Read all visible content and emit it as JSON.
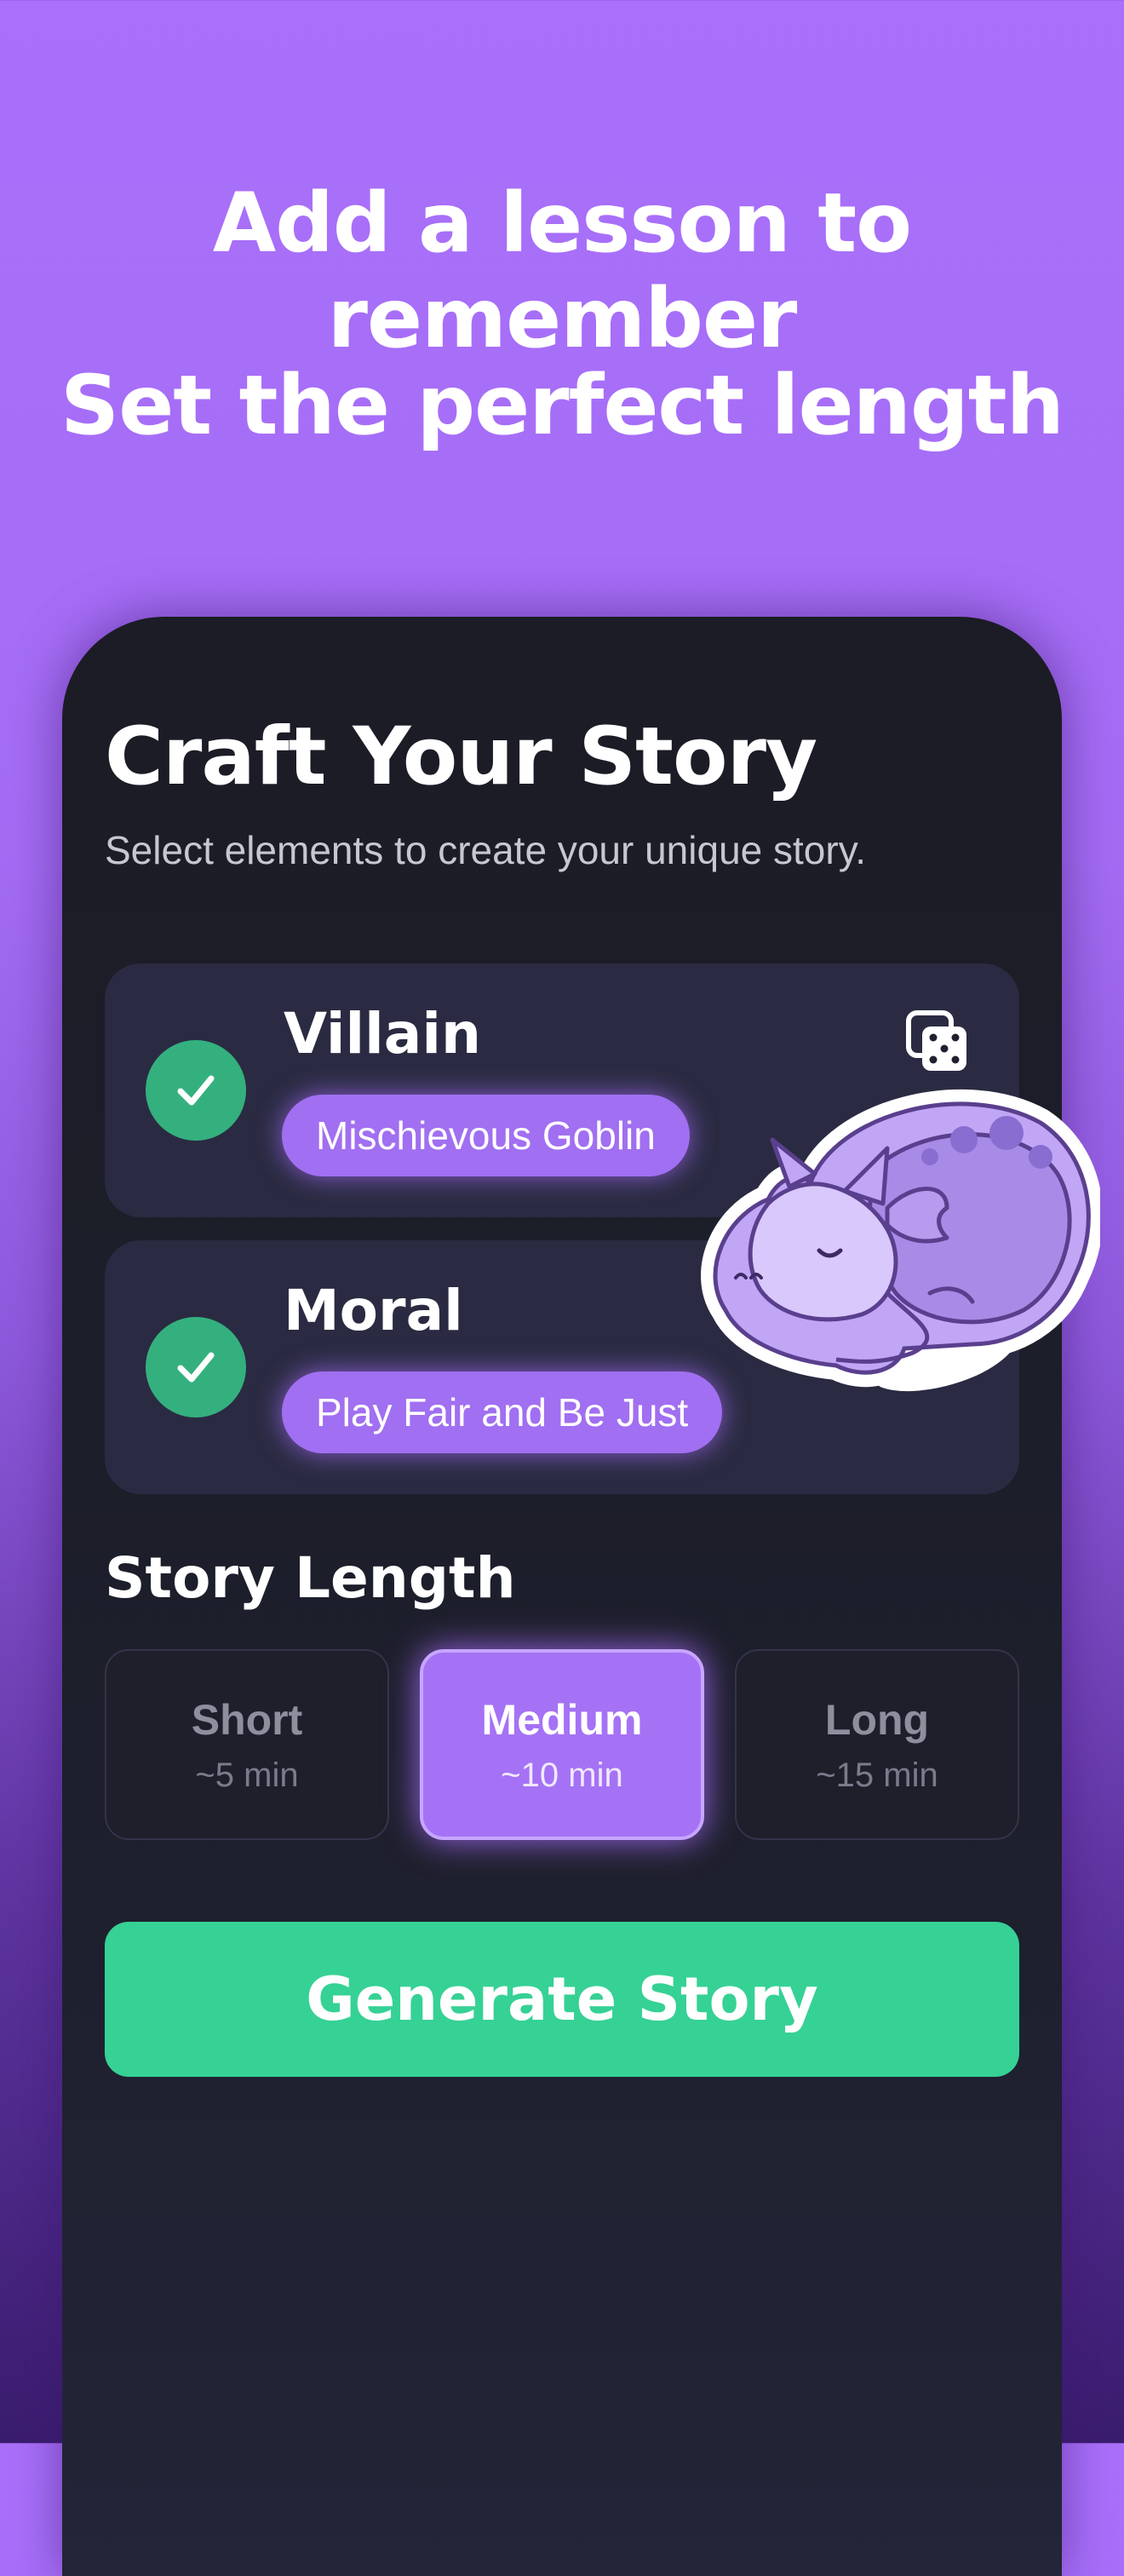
{
  "headlines": {
    "line1": "Add a lesson to remember",
    "line2": "Set the perfect length"
  },
  "screen": {
    "title": "Craft Your Story",
    "subtitle": "Select elements to create your unique story."
  },
  "elements": [
    {
      "label": "Villain",
      "value": "Mischievous Goblin",
      "selected": true
    },
    {
      "label": "Moral",
      "value": "Play Fair and Be Just",
      "selected": true
    }
  ],
  "randomize_icon": "dice-icon",
  "story_length": {
    "title": "Story Length",
    "options": [
      {
        "name": "Short",
        "duration": "~5 min",
        "selected": false
      },
      {
        "name": "Medium",
        "duration": "~10 min",
        "selected": true
      },
      {
        "name": "Long",
        "duration": "~15 min",
        "selected": false
      }
    ]
  },
  "generate_button": "Generate Story",
  "mascot": "sleeping-dragon-sticker",
  "colors": {
    "background_top": "#a970fb",
    "background_bottom": "#3a1d6e",
    "card_bg": "#2a2b42",
    "chip": "#a16ff1",
    "check": "#34b07f",
    "generate": "#36d195",
    "selected_length": "#a572f5"
  }
}
